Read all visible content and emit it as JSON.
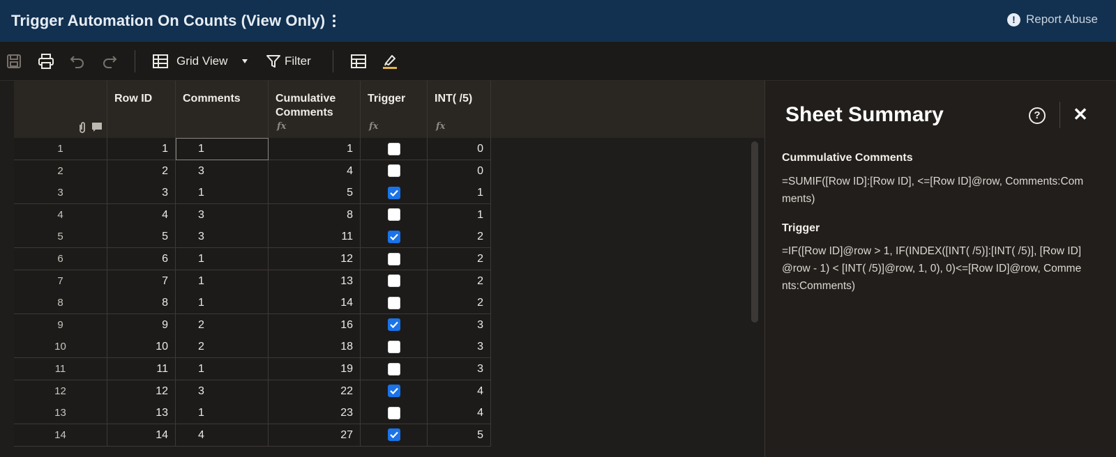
{
  "app": {
    "title": "Trigger Automation On Counts (View Only)",
    "report_abuse": "Report Abuse"
  },
  "toolbar": {
    "view_label": "Grid View",
    "filter_label": "Filter"
  },
  "columns": [
    {
      "label": "Row ID",
      "formula": false
    },
    {
      "label": "Comments",
      "formula": false
    },
    {
      "label": "Cumulative Comments",
      "formula": true
    },
    {
      "label": "Trigger",
      "formula": true
    },
    {
      "label": "INT( /5)",
      "formula": true
    }
  ],
  "formula_glyph": "fx",
  "rows": [
    {
      "n": "1",
      "id": "1",
      "comments": "1",
      "cum": "1",
      "trigger": false,
      "int": "0"
    },
    {
      "n": "2",
      "id": "2",
      "comments": "3",
      "cum": "4",
      "trigger": false,
      "int": "0"
    },
    {
      "n": "3",
      "id": "3",
      "comments": "1",
      "cum": "5",
      "trigger": true,
      "int": "1"
    },
    {
      "n": "4",
      "id": "4",
      "comments": "3",
      "cum": "8",
      "trigger": false,
      "int": "1"
    },
    {
      "n": "5",
      "id": "5",
      "comments": "3",
      "cum": "11",
      "trigger": true,
      "int": "2"
    },
    {
      "n": "6",
      "id": "6",
      "comments": "1",
      "cum": "12",
      "trigger": false,
      "int": "2"
    },
    {
      "n": "7",
      "id": "7",
      "comments": "1",
      "cum": "13",
      "trigger": false,
      "int": "2"
    },
    {
      "n": "8",
      "id": "8",
      "comments": "1",
      "cum": "14",
      "trigger": false,
      "int": "2"
    },
    {
      "n": "9",
      "id": "9",
      "comments": "2",
      "cum": "16",
      "trigger": true,
      "int": "3"
    },
    {
      "n": "10",
      "id": "10",
      "comments": "2",
      "cum": "18",
      "trigger": false,
      "int": "3"
    },
    {
      "n": "11",
      "id": "11",
      "comments": "1",
      "cum": "19",
      "trigger": false,
      "int": "3"
    },
    {
      "n": "12",
      "id": "12",
      "comments": "3",
      "cum": "22",
      "trigger": true,
      "int": "4"
    },
    {
      "n": "13",
      "id": "13",
      "comments": "1",
      "cum": "23",
      "trigger": false,
      "int": "4"
    },
    {
      "n": "14",
      "id": "14",
      "comments": "4",
      "cum": "27",
      "trigger": true,
      "int": "5"
    }
  ],
  "summary": {
    "title": "Sheet Summary",
    "fields": [
      {
        "label": "Cummulative Comments",
        "formula": "=SUMIF([Row ID]:[Row ID], <=[Row ID]@row, Comments:Comments)"
      },
      {
        "label": "Trigger",
        "formula": "=IF([Row ID]@row > 1, IF(INDEX([INT( /5)]:[INT( /5)], [Row ID]@row - 1) < [INT( /5)]@row, 1, 0), 0)<=[Row ID]@row, Comments:Comments)"
      }
    ]
  },
  "colors": {
    "titlebar": "#12304f",
    "checkbox_checked": "#1a73e8"
  }
}
